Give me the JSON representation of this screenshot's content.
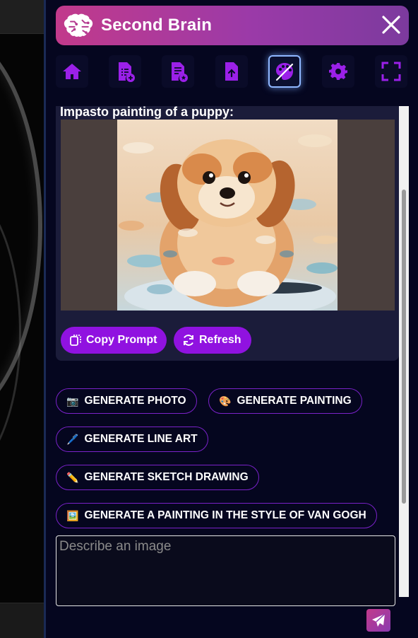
{
  "header": {
    "title": "Second Brain"
  },
  "toolbar": {
    "items": [
      {
        "name": "home-icon",
        "active": false
      },
      {
        "name": "add-document-icon",
        "active": false
      },
      {
        "name": "list-star-icon",
        "active": false
      },
      {
        "name": "upload-file-icon",
        "active": false
      },
      {
        "name": "palette-icon",
        "active": true
      },
      {
        "name": "settings-icon",
        "active": false
      },
      {
        "name": "fullscreen-icon",
        "active": false
      }
    ]
  },
  "result": {
    "prompt_title": "Impasto painting of a puppy:",
    "copy_label": "Copy Prompt",
    "refresh_label": "Refresh"
  },
  "generate": {
    "photo": {
      "emoji": "📷",
      "label": "GENERATE PHOTO"
    },
    "painting": {
      "emoji": "🎨",
      "label": "GENERATE PAINTING"
    },
    "line_art": {
      "emoji": "🖊️",
      "label": "GENERATE LINE ART"
    },
    "sketch": {
      "emoji": "✏️",
      "label": "GENERATE SKETCH DRAWING"
    },
    "van_gogh": {
      "emoji": "🖼️",
      "label": "GENERATE A PAINTING IN THE STYLE OF VAN GOGH"
    }
  },
  "input": {
    "placeholder": "Describe an image",
    "value": ""
  },
  "colors": {
    "accent": "#9012e0",
    "header_start": "#c23a8b",
    "header_end": "#7c3a9e",
    "panel_bg": "#05061f"
  }
}
